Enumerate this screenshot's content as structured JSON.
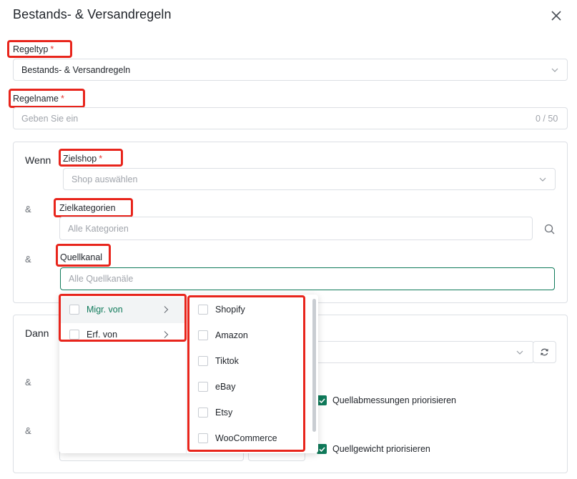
{
  "dialog": {
    "title": "Bestands- & Versandregeln",
    "close_label": "×"
  },
  "required_mark": "*",
  "regeltyp": {
    "label": "Regeltyp",
    "value": "Bestands- & Versandregeln"
  },
  "regelname": {
    "label": "Regelname",
    "placeholder": "Geben Sie ein",
    "counter": "0 / 50"
  },
  "wenn": {
    "heading": "Wenn",
    "zielshop": {
      "label": "Zielshop",
      "placeholder": "Shop auswählen"
    },
    "zielkategorien": {
      "amp": "&",
      "label": "Zielkategorien",
      "placeholder": "Alle Kategorien"
    },
    "quellkanal": {
      "amp": "&",
      "label": "Quellkanal",
      "placeholder": "Alle Quellkanäle"
    }
  },
  "dann": {
    "heading": "Dann",
    "amp1": "&",
    "amp2": "&",
    "option1": {
      "label": "Quellabmessungen priorisieren",
      "checked": true
    },
    "option2": {
      "label": "Quellgewicht priorisieren",
      "checked": true
    }
  },
  "cascader": {
    "groups": [
      {
        "label": "Migr. von",
        "active": true
      },
      {
        "label": "Erf. von",
        "active": false
      }
    ],
    "channels": [
      "Shopify",
      "Amazon",
      "Tiktok",
      "eBay",
      "Etsy",
      "WooCommerce"
    ]
  },
  "colors": {
    "accent": "#0f7a5a",
    "highlight": "#e8251c",
    "required": "#e53935"
  }
}
